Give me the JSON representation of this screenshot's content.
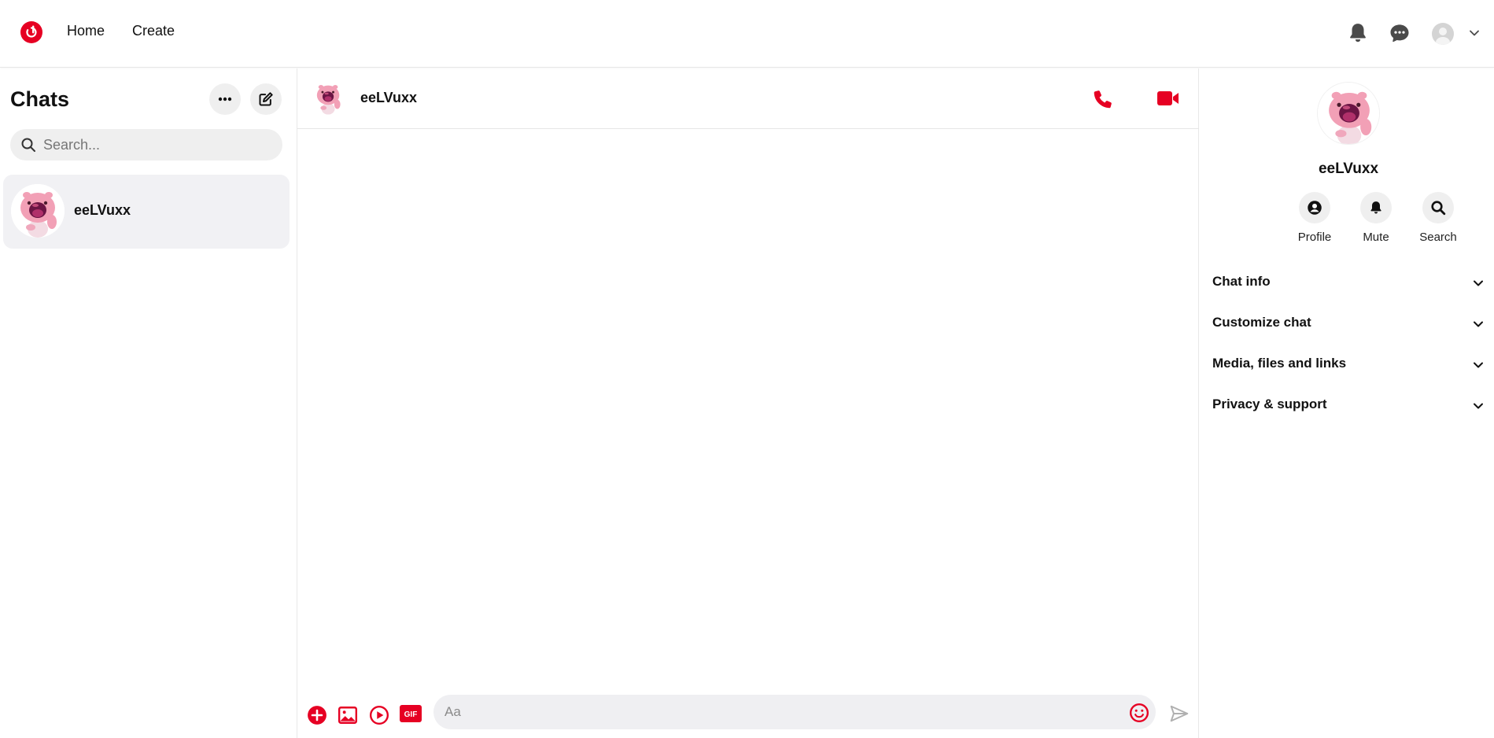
{
  "nav": {
    "home": "Home",
    "create": "Create"
  },
  "left": {
    "title": "Chats",
    "search_placeholder": "Search...",
    "chats": [
      {
        "name": "eeLVuxx"
      }
    ]
  },
  "conversation": {
    "name": "eeLVuxx",
    "composer_placeholder": "Aa",
    "gif_label": "GIF"
  },
  "details": {
    "name": "eeLVuxx",
    "actions": {
      "profile": "Profile",
      "mute": "Mute",
      "search": "Search"
    },
    "sections": {
      "chat_info": "Chat info",
      "customize": "Customize chat",
      "media": "Media, files and links",
      "privacy": "Privacy & support"
    }
  },
  "colors": {
    "brand": "#e60023",
    "selected_row": "#f1f1f4",
    "button_bg": "#efefef"
  },
  "icons": [
    "logo-icon",
    "bell-icon",
    "chat-bubble-icon",
    "chevron-down-icon",
    "more-icon",
    "compose-icon",
    "search-icon",
    "phone-icon",
    "video-icon",
    "plus-icon",
    "image-icon",
    "play-icon",
    "gif-icon",
    "emoji-icon",
    "send-icon",
    "profile-icon"
  ]
}
